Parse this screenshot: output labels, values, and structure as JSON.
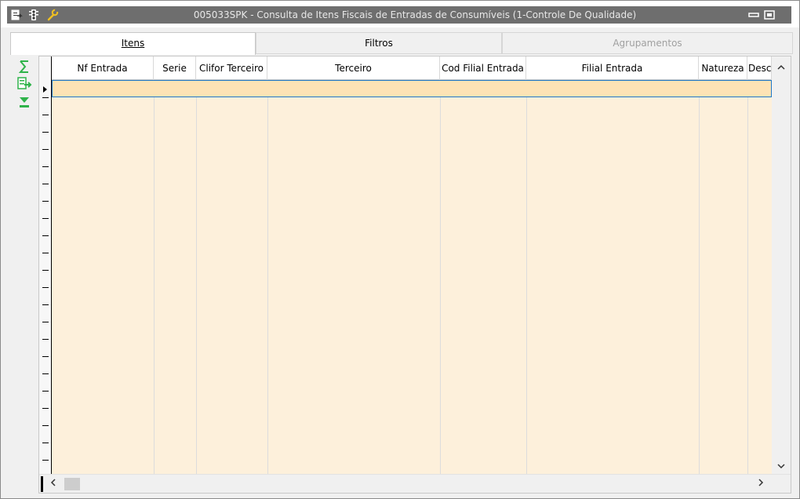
{
  "window": {
    "title": "005033SPK - Consulta de Itens Fiscais de Entradas de Consumíveis (1-Controle De Qualidade)"
  },
  "titlebar_icons": [
    "export-icon",
    "traffic-light-icon",
    "wrench-icon"
  ],
  "window_buttons": [
    "minimize-icon",
    "maximize-icon"
  ],
  "tabs": [
    {
      "label": "Itens",
      "state": "active"
    },
    {
      "label": "Filtros",
      "state": "normal"
    },
    {
      "label": "Agrupamentos",
      "state": "disabled"
    }
  ],
  "side_tools": [
    "sum-icon",
    "export-icon",
    "download-icon"
  ],
  "grid": {
    "columns": [
      "Nf Entrada",
      "Serie",
      "Clifor Terceiro",
      "Terceiro",
      "Cod Filial Entrada",
      "Filial Entrada",
      "Natureza",
      "Desc"
    ],
    "rows": []
  },
  "scroll": {
    "up": "^",
    "down": "v",
    "left": "<",
    "right": ">"
  },
  "colors": {
    "grid_background": "#fdf0db",
    "selected_row": "#fde3b5",
    "selection_border": "#1e78c8",
    "icon_green": "#2fb34a",
    "titlebar": "#6e6e6e"
  }
}
